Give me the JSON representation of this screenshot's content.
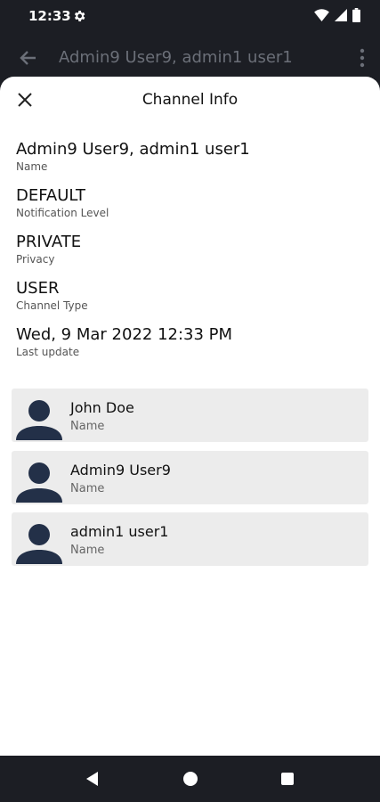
{
  "status": {
    "time": "12:33"
  },
  "app_bar": {
    "title": "Admin9 User9, admin1 user1"
  },
  "sheet": {
    "title": "Channel Info",
    "info": [
      {
        "value": "Admin9 User9, admin1 user1",
        "label": "Name"
      },
      {
        "value": "DEFAULT",
        "label": "Notification Level"
      },
      {
        "value": "PRIVATE",
        "label": "Privacy"
      },
      {
        "value": "USER",
        "label": "Channel Type"
      },
      {
        "value": "Wed, 9 Mar 2022 12:33 PM",
        "label": "Last update"
      }
    ],
    "members": [
      {
        "name": "John Doe",
        "sub": "Name"
      },
      {
        "name": "Admin9 User9",
        "sub": "Name"
      },
      {
        "name": "admin1 user1",
        "sub": "Name"
      }
    ]
  },
  "colors": {
    "system_bg": "#1c1e24",
    "sheet_bg": "#ffffff",
    "member_card_bg": "#ececec",
    "avatar": "#233048"
  },
  "icons": {
    "status": [
      "gear-icon",
      "wifi-icon",
      "signal-icon",
      "battery-icon"
    ],
    "app_bar": [
      "back-arrow-icon",
      "more-vert-icon"
    ],
    "sheet": [
      "close-icon",
      "person-avatar-icon"
    ],
    "nav": [
      "nav-back-icon",
      "nav-home-icon",
      "nav-recents-icon"
    ]
  }
}
